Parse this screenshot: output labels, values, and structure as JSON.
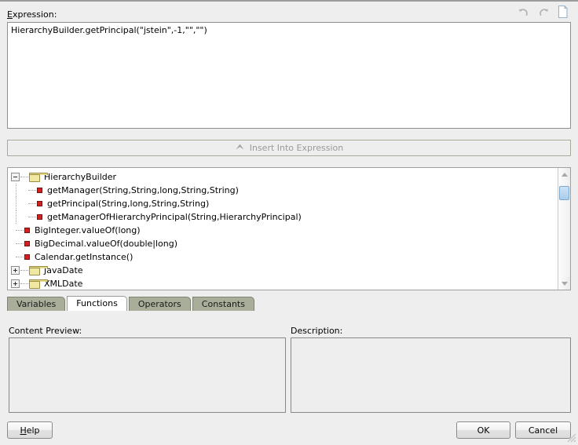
{
  "dialog": {
    "expression_label": "Expression:",
    "expression_label_mnemonic": "E",
    "expression_label_rest": "xpression:",
    "expression_value": "HierarchyBuilder.getPrincipal(\"jstein\",-1,\"\",\"\")",
    "insert_button_label": "Insert Into Expression"
  },
  "toolbar": {
    "undo_icon": "undo-icon",
    "redo_icon": "redo-icon",
    "new_document_icon": "new-document-icon"
  },
  "tree": {
    "nodes": [
      {
        "label": "HierarchyBuilder",
        "type": "folder",
        "state": "expanded",
        "depth": 0
      },
      {
        "label": "getManager(String,String,long,String,String)",
        "type": "method",
        "depth": 1
      },
      {
        "label": "getPrincipal(String,long,String,String)",
        "type": "method",
        "depth": 1
      },
      {
        "label": "getManagerOfHierarchyPrincipal(String,HierarchyPrincipal)",
        "type": "method",
        "depth": 1
      },
      {
        "label": "BigInteger.valueOf(long)",
        "type": "method",
        "depth": 0
      },
      {
        "label": "BigDecimal.valueOf(double|long)",
        "type": "method",
        "depth": 0
      },
      {
        "label": "Calendar.getInstance()",
        "type": "method",
        "depth": 0
      },
      {
        "label": "JavaDate",
        "type": "folder",
        "state": "collapsed",
        "depth": 0
      },
      {
        "label": "XMLDate",
        "type": "folder",
        "state": "collapsed",
        "depth": 0
      }
    ]
  },
  "tabs": {
    "items": [
      {
        "label": "Variables",
        "active": false
      },
      {
        "label": "Functions",
        "active": true
      },
      {
        "label": "Operators",
        "active": false
      },
      {
        "label": "Constants",
        "active": false
      }
    ]
  },
  "panels": {
    "content_preview_label": "Content Preview:",
    "content_preview_value": "",
    "description_label": "Description:",
    "description_value": ""
  },
  "buttons": {
    "help_mnemonic": "H",
    "help_rest": "elp",
    "help_label": "Help",
    "ok_label": "OK",
    "cancel_label": "Cancel"
  },
  "colors": {
    "background": "#eeeeee",
    "field_background": "#ffffff",
    "tab_inactive": "#a8ae9a",
    "method_icon": "#d02020",
    "folder_icon": "#f0e7a2",
    "scrollbar_thumb": "#a8cdeb",
    "disabled_text": "#9a9a9a"
  }
}
